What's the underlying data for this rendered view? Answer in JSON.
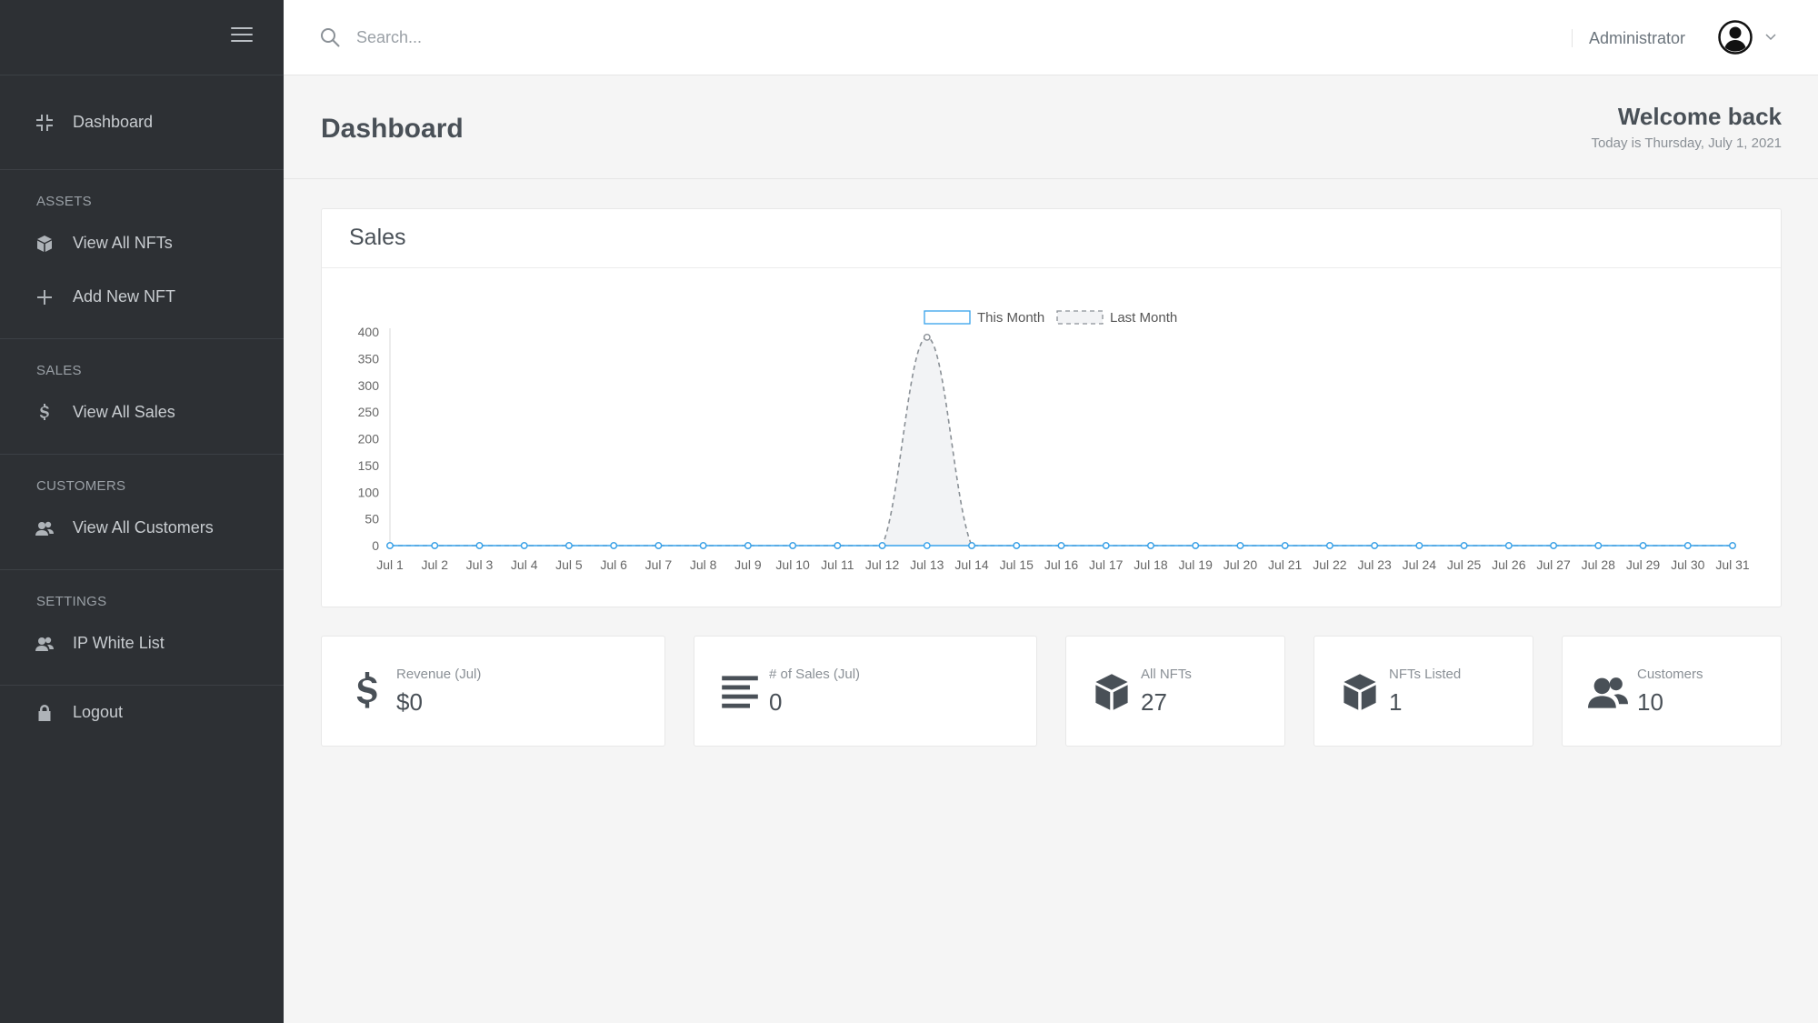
{
  "sidebar": {
    "items": {
      "dashboard": "Dashboard",
      "view_all_nfts": "View All NFTs",
      "add_new_nft": "Add New NFT",
      "view_all_sales": "View All Sales",
      "view_all_customers": "View All Customers",
      "ip_white_list": "IP White List",
      "logout": "Logout"
    },
    "sections": {
      "assets": "ASSETS",
      "sales": "SALES",
      "customers": "CUSTOMERS",
      "settings": "SETTINGS"
    },
    "icons": {
      "dashboard": "compress-icon",
      "view_all_nfts": "cube-icon",
      "add_new_nft": "plus-icon",
      "view_all_sales": "dollar-icon",
      "view_all_customers": "users-icon",
      "ip_white_list": "users-icon",
      "logout": "lock-icon"
    }
  },
  "topbar": {
    "search_placeholder": "Search...",
    "user_name": "Administrator"
  },
  "header": {
    "title": "Dashboard",
    "welcome": "Welcome back",
    "today": "Today is Thursday, July 1, 2021"
  },
  "sales_card": {
    "title": "Sales"
  },
  "chart_data": {
    "type": "line",
    "title": "",
    "xlabel": "",
    "ylabel": "",
    "ylim": [
      0,
      400
    ],
    "yticks": [
      0,
      50,
      100,
      150,
      200,
      250,
      300,
      350,
      400
    ],
    "categories": [
      "Jul 1",
      "Jul 2",
      "Jul 3",
      "Jul 4",
      "Jul 5",
      "Jul 6",
      "Jul 7",
      "Jul 8",
      "Jul 9",
      "Jul 10",
      "Jul 11",
      "Jul 12",
      "Jul 13",
      "Jul 14",
      "Jul 15",
      "Jul 16",
      "Jul 17",
      "Jul 18",
      "Jul 19",
      "Jul 20",
      "Jul 21",
      "Jul 22",
      "Jul 23",
      "Jul 24",
      "Jul 25",
      "Jul 26",
      "Jul 27",
      "Jul 28",
      "Jul 29",
      "Jul 30",
      "Jul 31"
    ],
    "series": [
      {
        "name": "This Month",
        "color": "#36a2eb",
        "style": "solid",
        "values": [
          0,
          0,
          0,
          0,
          0,
          0,
          0,
          0,
          0,
          0,
          0,
          0,
          0,
          0,
          0,
          0,
          0,
          0,
          0,
          0,
          0,
          0,
          0,
          0,
          0,
          0,
          0,
          0,
          0,
          0,
          0
        ]
      },
      {
        "name": "Last Month",
        "color": "#8a9096",
        "style": "dashed",
        "fill": "#f2f3f5",
        "values": [
          0,
          0,
          0,
          0,
          0,
          0,
          0,
          0,
          0,
          0,
          0,
          0,
          390,
          0,
          0,
          0,
          0,
          0,
          0,
          0,
          0,
          0,
          0,
          0,
          0,
          0,
          0,
          0,
          0,
          0,
          0
        ]
      }
    ],
    "legend": "top-center",
    "grid": false
  },
  "stats": [
    {
      "icon": "dollar-icon",
      "label": "Revenue (Jul)",
      "value": "$0"
    },
    {
      "icon": "bars-icon",
      "label": "# of Sales (Jul)",
      "value": "0"
    },
    {
      "icon": "cube-icon",
      "label": "All NFTs",
      "value": "27"
    },
    {
      "icon": "cube-icon",
      "label": "NFTs Listed",
      "value": "1"
    },
    {
      "icon": "users-icon",
      "label": "Customers",
      "value": "10"
    }
  ]
}
